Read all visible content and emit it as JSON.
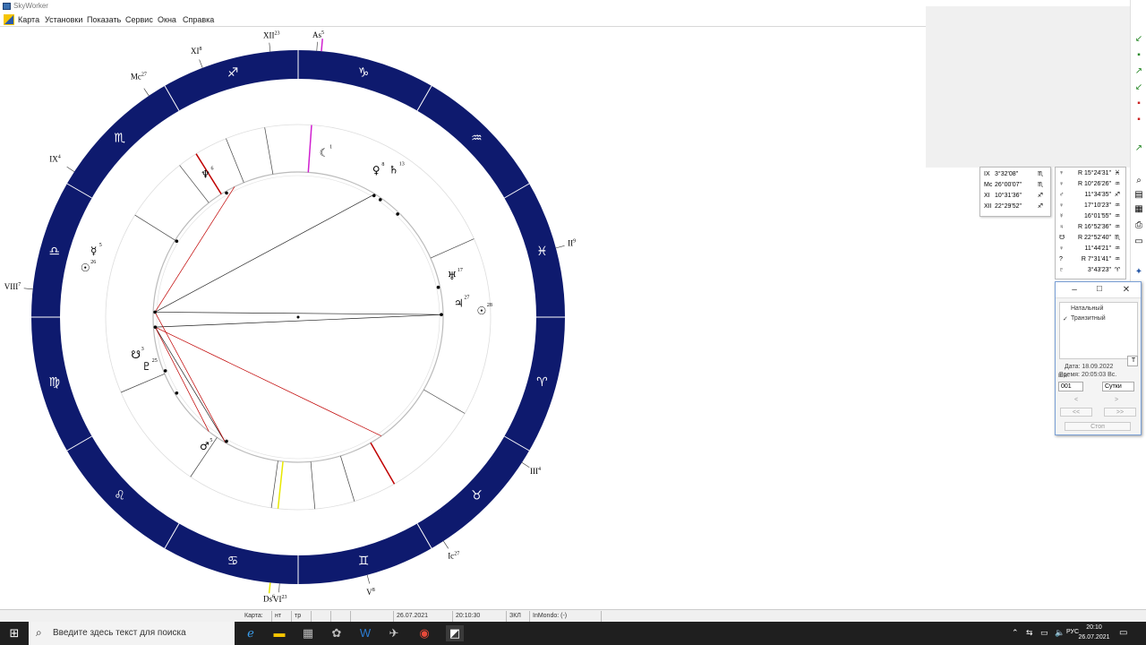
{
  "window": {
    "title": "SkyWorker"
  },
  "menu": [
    "Карта",
    "Установки",
    "Показать",
    "Сервис",
    "Окна",
    "Справка"
  ],
  "zodiac_signs": [
    {
      "name": "sagittarius-icon",
      "glyph": "♐"
    },
    {
      "name": "capricorn-icon",
      "glyph": "♑"
    },
    {
      "name": "aquarius-icon",
      "glyph": "♒"
    },
    {
      "name": "pisces-icon",
      "glyph": "♓"
    },
    {
      "name": "aries-icon",
      "glyph": "♈"
    },
    {
      "name": "taurus-icon",
      "glyph": "♉"
    },
    {
      "name": "gemini-icon",
      "glyph": "♊"
    },
    {
      "name": "cancer-icon",
      "glyph": "♋"
    },
    {
      "name": "leo-icon",
      "glyph": "♌"
    },
    {
      "name": "virgo-icon",
      "glyph": "♍"
    },
    {
      "name": "libra-icon",
      "glyph": "♎"
    },
    {
      "name": "scorpio-icon",
      "glyph": "♏"
    }
  ],
  "houses": [
    {
      "label": "As",
      "deg": "5"
    },
    {
      "label": "II",
      "deg": "9"
    },
    {
      "label": "III",
      "deg": "4"
    },
    {
      "label": "Ic",
      "deg": "27"
    },
    {
      "label": "V",
      "deg": "8"
    },
    {
      "label": "VI",
      "deg": "23"
    },
    {
      "label": "Ds",
      "deg": "6"
    },
    {
      "label": "VIII",
      "deg": "7"
    },
    {
      "label": "IX",
      "deg": "4"
    },
    {
      "label": "Mc",
      "deg": "27"
    },
    {
      "label": "XI",
      "deg": "8"
    },
    {
      "label": "XII",
      "deg": "23"
    }
  ],
  "planets": [
    {
      "name": "moon-icon",
      "glyph": "☾",
      "deg": "1"
    },
    {
      "name": "neptune-icon",
      "glyph": "♆",
      "deg": "6"
    },
    {
      "name": "venus-icon",
      "glyph": "♀",
      "deg": "8"
    },
    {
      "name": "saturn-icon",
      "glyph": "♄",
      "deg": "13"
    },
    {
      "name": "uranus-icon",
      "glyph": "♅",
      "deg": "17"
    },
    {
      "name": "jupiter-icon",
      "glyph": "♃",
      "deg": "27"
    },
    {
      "name": "sun-icon",
      "glyph": "☉",
      "deg": "28"
    },
    {
      "name": "mercury-icon",
      "glyph": "☿",
      "deg": "5"
    },
    {
      "name": "sun-natal-icon",
      "glyph": "☉",
      "deg": "26"
    },
    {
      "name": "pluto-icon",
      "glyph": "♇",
      "deg": "25"
    },
    {
      "name": "node-icon",
      "glyph": "☋",
      "deg": "3"
    },
    {
      "name": "mars-icon",
      "glyph": "♂",
      "deg": "5"
    }
  ],
  "house_table": [
    {
      "glyph": "IX",
      "value": "3°32'08\"",
      "sign": "♏"
    },
    {
      "glyph": "Mc",
      "value": "26°00'07\"",
      "sign": "♏"
    },
    {
      "glyph": "XI",
      "value": "10°31'36\"",
      "sign": "♐"
    },
    {
      "glyph": "XII",
      "value": "22°29'52\"",
      "sign": "♐"
    }
  ],
  "planet_table": [
    {
      "glyph": "♆",
      "value": "R 15°24'31\"",
      "sign": "♓"
    },
    {
      "glyph": "♀",
      "value": "R 10°26'26\"",
      "sign": "♒"
    },
    {
      "glyph": "♂",
      "value": "11°34'35\"",
      "sign": "♐"
    },
    {
      "glyph": "♀",
      "value": "17°10'23\"",
      "sign": "♒"
    },
    {
      "glyph": "☿",
      "value": "16°01'55\"",
      "sign": "♒"
    },
    {
      "glyph": "♃",
      "value": "R 16°52'36\"",
      "sign": "♒"
    },
    {
      "glyph": "☋",
      "value": "R 22°52'40\"",
      "sign": "♏"
    },
    {
      "glyph": "♀",
      "value": "11°44'21\"",
      "sign": "♒"
    },
    {
      "glyph": "?",
      "value": "R 7°31'41\"",
      "sign": "♒"
    },
    {
      "glyph": "♇",
      "value": "3°43'23\"",
      "sign": "♈"
    }
  ],
  "dialog": {
    "options": [
      "Натальный",
      "Транзитный"
    ],
    "checked": "✓",
    "date_label": "Дата: 18.09.2022",
    "time_label": "Время: 20:05:03 Вс.",
    "step_label": "Шаг:",
    "step_value": "001",
    "unit": "Сутки",
    "prev": "<",
    "next": ">",
    "fast_prev": "<<",
    "fast_next": ">>",
    "stop": "Стоп",
    "minimize": "–",
    "maximize": "☐",
    "close": "✕",
    "t_button": "T"
  },
  "statusbar": {
    "map": "Карта:",
    "c1": "нт",
    "c2": "тр",
    "date": "26.07.2021",
    "time": "20:10:30",
    "mode": "ЗКЛ",
    "inmondo": "InMondo: (-)"
  },
  "taskbar": {
    "search_placeholder": "Введите здесь текст для поиска",
    "lang": "РУС",
    "time": "20:10",
    "date": "26.07.2021"
  }
}
